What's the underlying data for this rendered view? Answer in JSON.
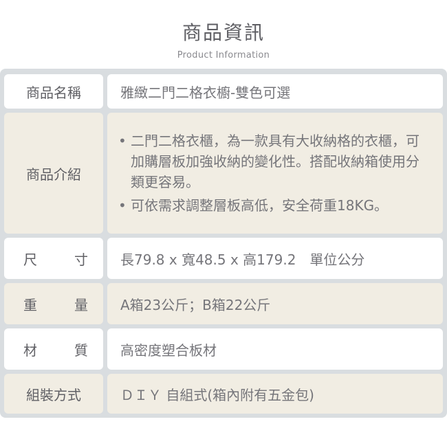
{
  "header": {
    "title": "商品資訊",
    "subtitle": "Product Information"
  },
  "rows": [
    {
      "label": "商品名稱",
      "label_chars": null,
      "value": "雅緻二門二格衣櫥-雙色可選",
      "bg": "white"
    },
    {
      "label": "商品介紹",
      "label_chars": null,
      "bullets": [
        "二門二格衣櫃，為一款具有大收納格的衣櫃，可加購層板加強收納的變化性。搭配收納箱使用分類更容易。",
        "可依需求調整層板高低，安全荷重18KG。"
      ],
      "bg": "beige"
    },
    {
      "label": "尺寸",
      "label_chars": [
        "尺",
        "寸"
      ],
      "value": "長79.8 x 寬48.5 x 高179.2　單位公分",
      "bg": "white"
    },
    {
      "label": "重量",
      "label_chars": [
        "重",
        "量"
      ],
      "value": "A箱23公斤；B箱22公斤",
      "bg": "beige"
    },
    {
      "label": "材質",
      "label_chars": [
        "材",
        "質"
      ],
      "value": "高密度塑合板材",
      "bg": "white"
    },
    {
      "label": "組裝方式",
      "label_chars": null,
      "value": "ＤＩＹ 自組式(箱內附有五金包)",
      "bg": "beige"
    }
  ],
  "bullet_symbol": "•",
  "colors": {
    "frame": "#d9dde0",
    "white_row": "#ffffff",
    "beige_row": "#f1ede3",
    "text": "#75757a",
    "label_text": "#606065"
  }
}
